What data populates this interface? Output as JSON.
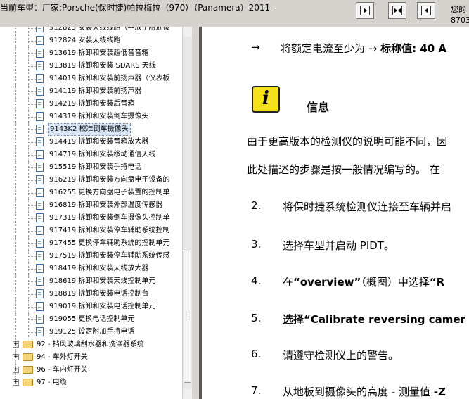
{
  "titlebar": {
    "title": "当前车型：厂家:Porsche(保时捷)帕拉梅拉（970）（Panamera）2011-",
    "right_line1": "您的",
    "right_line2": "8703"
  },
  "toolbar": {
    "buttons": [
      {
        "name": "nav-next-button",
        "icon": "arrow-right-icon"
      },
      {
        "name": "nav-expand-button",
        "icon": "double-arrow-icon"
      },
      {
        "name": "nav-prev-button",
        "icon": "arrow-left-icon"
      }
    ]
  },
  "tree": {
    "doc_items": [
      {
        "label": "912823 安装天线线路（半放于附近接"
      },
      {
        "label": "912824 安装天线线路"
      },
      {
        "label": "913619 拆卸和安装超低音音箱"
      },
      {
        "label": "913819 拆卸和安装 SDARS 天线"
      },
      {
        "label": "914019 拆卸和安装前扬声器（仪表板"
      },
      {
        "label": "914119 拆卸和安装前扬声器"
      },
      {
        "label": "914219 拆卸和安装后音箱"
      },
      {
        "label": "914319 拆卸和安装倒车摄像头"
      },
      {
        "label": "9143K2 校准倒车摄像头",
        "selected": true
      },
      {
        "label": "914419 拆卸和安装音箱放大器"
      },
      {
        "label": "914719 拆卸和安装移动通信天线"
      },
      {
        "label": "915519 拆卸和安装手持电话"
      },
      {
        "label": "916219 拆卸和安装方向盘电子设备的"
      },
      {
        "label": "916255 更换方向盘电子装置的控制单"
      },
      {
        "label": "916819 拆卸和安装外部温度传感器"
      },
      {
        "label": "917319 拆卸和安装倒车摄像头控制单"
      },
      {
        "label": "917419 拆卸和安装停车辅助系统控制"
      },
      {
        "label": "917455 更换停车辅助系统的控制单元"
      },
      {
        "label": "917519 拆卸和安装停车辅助系统传感"
      },
      {
        "label": "918419 拆卸和安装天线放大器"
      },
      {
        "label": "918619 拆卸和安装天线控制单元"
      },
      {
        "label": "918819 拆卸和安装电话控制台"
      },
      {
        "label": "919019 拆卸和安装电话控制单元"
      },
      {
        "label": "919055 更换电话控制单元"
      },
      {
        "label": "919125 设定附加手持电话"
      }
    ],
    "folders": [
      {
        "label": "92 - 挡风玻璃刮水器和洗涤器系统"
      },
      {
        "label": "94 - 车外灯开关"
      },
      {
        "label": "96 - 车内灯开关"
      },
      {
        "label": "97 - 电缆"
      }
    ]
  },
  "content": {
    "arrow_line": {
      "arrow": "→",
      "text": "将额定电流至少为 → ",
      "bold": "标称值: 40 A"
    },
    "info_icon_letter": "i",
    "info_heading": "信息",
    "para_line1": "由于更高版本的检测仪的说明可能不同，因",
    "para_line2": "此处描述的步骤是按一般情况编写的。 在",
    "steps": [
      {
        "num": "2.",
        "text": "将保时捷系统检测仪连接至车辆并启"
      },
      {
        "num": "3.",
        "text": "选择车型并启动  PIDT。"
      },
      {
        "num": "4.",
        "pre": "在",
        "bold": "“overview”",
        "post": "（概图）中选择",
        "bold2": "“R"
      },
      {
        "num": "5.",
        "bold": "选择“Calibrate reversing camer"
      },
      {
        "num": "6.",
        "text": "请遵守检测仪上的警告。"
      },
      {
        "num": "7.",
        "text": "从地板到摄像头的高度  - 测量值  ",
        "bold": "-Z"
      }
    ]
  },
  "colors": {
    "toolbar_bg": "#d6d3ce",
    "selection_bg": "#d6e4f3",
    "info_icon_bg": "#f5e11a"
  }
}
